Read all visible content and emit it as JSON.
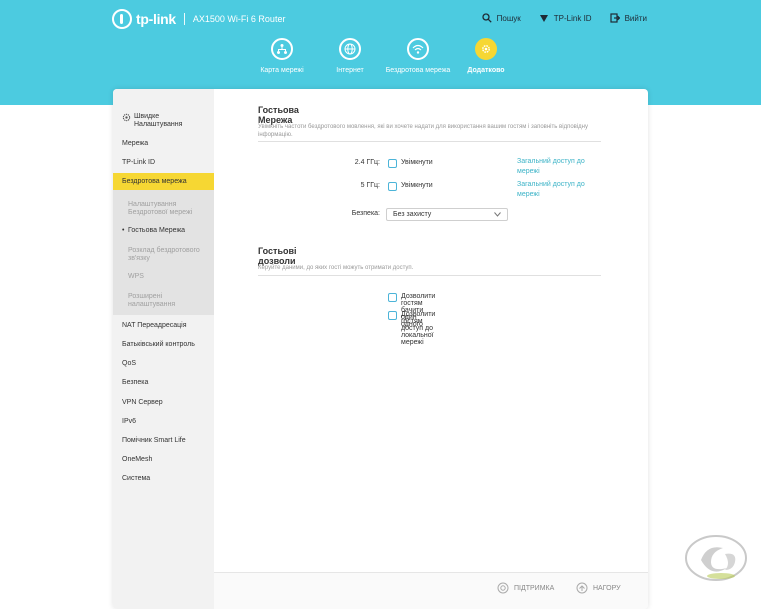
{
  "header": {
    "brand": "tp-link",
    "model": "AX1500 Wi-Fi 6 Router",
    "actions": [
      {
        "label": "Пошук",
        "icon": "search-icon"
      },
      {
        "label": "TP-Link ID",
        "icon": "tplink-id-icon"
      },
      {
        "label": "Вийти",
        "icon": "logout-icon"
      }
    ]
  },
  "nav": {
    "items": [
      {
        "label": "Карта мережі",
        "icon": "network-map-icon"
      },
      {
        "label": "Інтернет",
        "icon": "globe-icon"
      },
      {
        "label": "Бездротова мережа",
        "icon": "wifi-icon"
      },
      {
        "label": "Додатково",
        "icon": "gear-icon",
        "active": true
      }
    ]
  },
  "sidebar": {
    "quick_setup": "Швидке Налаштування",
    "items": [
      "Мережа",
      "TP-Link ID",
      "Бездротова мережа",
      "NAT Переадресація",
      "Батьківський контроль",
      "QoS",
      "Безпека",
      "VPN Сервер",
      "IPv6",
      "Помічник Smart Life",
      "OneMesh",
      "Система"
    ],
    "subitems": [
      "Налаштування Бездротової мережі",
      "Гостьова Мережа",
      "Розклад бездротового зв'язку",
      "WPS",
      "Розширені налаштування"
    ]
  },
  "guest": {
    "title": "Гостьова Мережа",
    "description": "Увімкніть частоти бездротового мовлення, які ви хочете надати для використання вашим гостям і заповніть відповідну інформацію.",
    "band24_label": "2.4 ГГц:",
    "band5_label": "5 ГГц:",
    "enable_label": "Увімкнути",
    "share_link": "Загальний доступ до мережі",
    "security_label": "Безпека:",
    "security_value": "Без захисту"
  },
  "permissions": {
    "title": "Гостьові дозволи",
    "description": "Керуйте даними, до яких гості можуть отримати доступ.",
    "see_each_other": "Дозволити гостям бачити один одного",
    "local_access": "Дозволити гостям доступ до локальної мережі"
  },
  "footer": {
    "support": "ПІДТРИМКА",
    "top": "НАГОРУ"
  },
  "colors": {
    "header_bg": "#4ccbe0",
    "accent": "#f6d733",
    "link": "#3cb3c7"
  }
}
